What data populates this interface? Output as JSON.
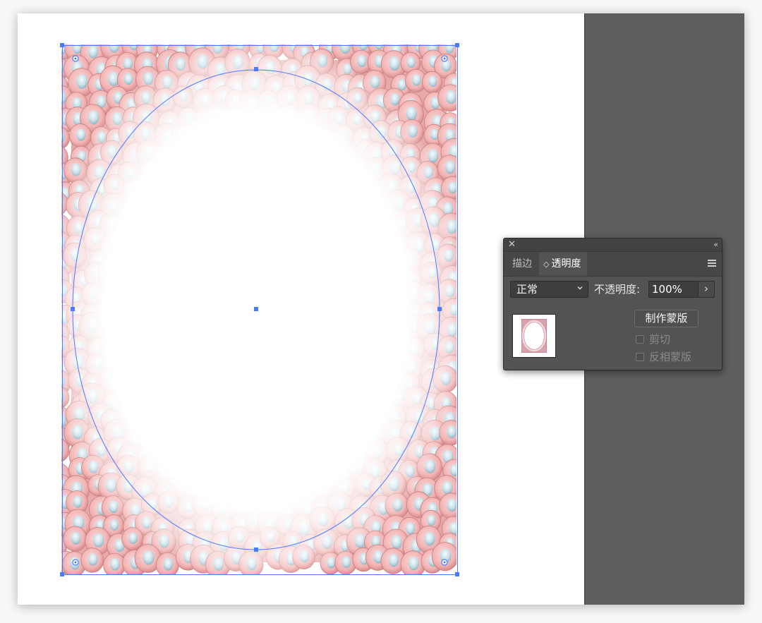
{
  "panel": {
    "tabs": [
      {
        "label": "描边"
      },
      {
        "label": "透明度"
      }
    ],
    "blend_mode": "正常",
    "opacity_label": "不透明度:",
    "opacity_value": "100%",
    "make_mask_label": "制作蒙版",
    "clip_label": "剪切",
    "clip_checked": false,
    "invert_mask_label": "反相蒙版",
    "invert_mask_checked": false
  },
  "icons": {
    "close": "close-icon",
    "collapse": "collapse-double-chevron-icon",
    "tab_arrows": "updown-arrows-icon",
    "panel_menu": "hamburger-menu-icon",
    "select_chevron": "chevron-down-icon",
    "opacity_arrow": "chevron-right-icon"
  },
  "colors": {
    "selection": "#4a7bff",
    "bubble_fill": "#f2b8b8",
    "bubble_dark": "#d98b8b",
    "bubble_highlight": "#cfe3ec",
    "frame_backing": "#e7a9a9",
    "pasteboard": "#5e5e5e",
    "panel_bg": "#535353"
  }
}
